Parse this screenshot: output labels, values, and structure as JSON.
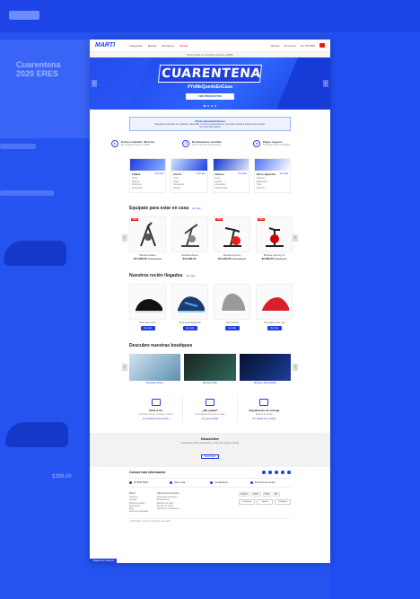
{
  "background": {
    "hero_text": "Cuarentena\n2020 ERES",
    "price_left": "$399.00"
  },
  "topbar": {
    "logo": "MARTI",
    "menu": [
      "Categorías",
      "Marcas",
      "Boutiques",
      "Ofertas"
    ],
    "right": [
      "Buscar",
      "Mi cuenta",
      "Tel: 55 5555"
    ],
    "cart_icon": "cart-icon"
  },
  "shipping_bar": "Envío gratis en compras mayores a $999",
  "hero": {
    "title": "CUARENTENA",
    "hashtag": "#YoMeQuedoEnCasa",
    "cta": "VER PRODUCTOS",
    "prev": "‹",
    "next": "›"
  },
  "notice": {
    "heading": "#TodosQuedateEnCasa",
    "text": "Seguimos enviando tus pedidos a domicilio, toma tus precauciones. Consulta nuestros tiempos de entrega.",
    "link": "Ver más información"
  },
  "benefits": [
    {
      "title": "Envíos estándar: 48 horas",
      "sub": "En compras mayores a $999",
      "icon": "truck-icon"
    },
    {
      "title": "Devoluciones sencillas",
      "sub": "Tienes 30 días para devolver",
      "icon": "return-icon"
    },
    {
      "title": "Pagos seguros",
      "sub": "Tus datos están protegidos",
      "icon": "lock-icon"
    }
  ],
  "categories": [
    {
      "name": "Fútbol",
      "more": "Ver todo",
      "items": [
        "Tacos",
        "Balones",
        "Uniformes",
        "Accesorios"
      ],
      "color": "#1f3fe0"
    },
    {
      "name": "Correr",
      "more": "Ver todo",
      "items": [
        "Tenis",
        "Ropa",
        "Accesorios",
        "Relojes"
      ],
      "color": "#3fa9f5"
    },
    {
      "name": "Fitness",
      "more": "Ver todo",
      "items": [
        "Ropa",
        "Equipo",
        "Accesorios",
        "Suplementos"
      ],
      "color": "#1336c9"
    },
    {
      "name": "Otros deportes",
      "more": "Ver todo",
      "items": [
        "Natación",
        "Básquetbol",
        "Tenis",
        "Ciclismo"
      ],
      "color": "#4d73f6"
    }
  ],
  "section_home": {
    "title": "Equípate para estar en casa",
    "more": "Ver más",
    "products": [
      {
        "badge": "-20%",
        "name": "Bicicleta estática",
        "price": "$14,999.00",
        "old": "$18,999.00"
      },
      {
        "badge": "",
        "name": "Bicicleta elíptica",
        "price": "$11,999.00",
        "old": ""
      },
      {
        "badge": "-15%",
        "name": "Bicicleta spinning",
        "price": "$11,999.00",
        "old": "$13,999.00"
      },
      {
        "badge": "-10%",
        "name": "Bicicleta spinning pro",
        "price": "$5,999.00",
        "old": "$6,699.00"
      }
    ]
  },
  "section_new": {
    "title": "Nuestros recién llegados",
    "more": "Ver más",
    "products": [
      {
        "name": "Tenis para correr",
        "btn": "Ver más"
      },
      {
        "name": "Tenis para básquetbol",
        "btn": "Ver más"
      },
      {
        "name": "Tenis casual",
        "btn": "Ver más"
      },
      {
        "name": "Tenis para correr rojo",
        "btn": "Ver más"
      }
    ]
  },
  "section_boutiques": {
    "title": "Descubre nuestras boutiques",
    "items": [
      {
        "name": "Boutique fitness",
        "color": "#7fa9c9"
      },
      {
        "name": "Boutique Nike",
        "color": "#2d3b3a"
      },
      {
        "name": "Boutique Real Madrid",
        "color": "#0b1a5c"
      }
    ]
  },
  "services": [
    {
      "title": "Click & Go",
      "sub": "Compra en línea y recoge en tienda",
      "link": "Ver condiciones del servicio"
    },
    {
      "title": "¿Me queda?",
      "sub": "Consulta nuestra guía de tallas",
      "link": "Ver guía de tallas"
    },
    {
      "title": "Seguimiento de entrega",
      "sub": "Rastrea tu pedido",
      "link": "Ver estatus de tu pedido"
    }
  ],
  "newsletter": {
    "title": "Newsletter",
    "sub": "Suscríbete a Martí Newsletter y recibe las mejores ofertas",
    "button": "Suscríbete"
  },
  "footer": {
    "title": "Conoce más información",
    "contacts": [
      "55 5555 5555",
      "Haz tu cita",
      "Contáctanos",
      "Encuentra tu tienda"
    ],
    "col1": {
      "heading": "Martí",
      "items": [
        "Nosotros",
        "Tiendas",
        "Bolsa de trabajo",
        "Facturación",
        "Blog",
        "Aviso de privacidad"
      ]
    },
    "col2": {
      "heading": "Atención al cliente",
      "items": [
        "Preguntas frecuentes",
        "Devoluciones",
        "Métodos de pago",
        "Formas de envío",
        "Términos y condiciones"
      ]
    },
    "payments": [
      "PayPal",
      "OXXO",
      "VISA",
      "MC"
    ],
    "seals": [
      "Certificado",
      "Norton",
      "Confianza"
    ],
    "copyright": "© 2020 Martí. Todos los derechos reservados.",
    "chat": "Chatea con nosotros"
  }
}
